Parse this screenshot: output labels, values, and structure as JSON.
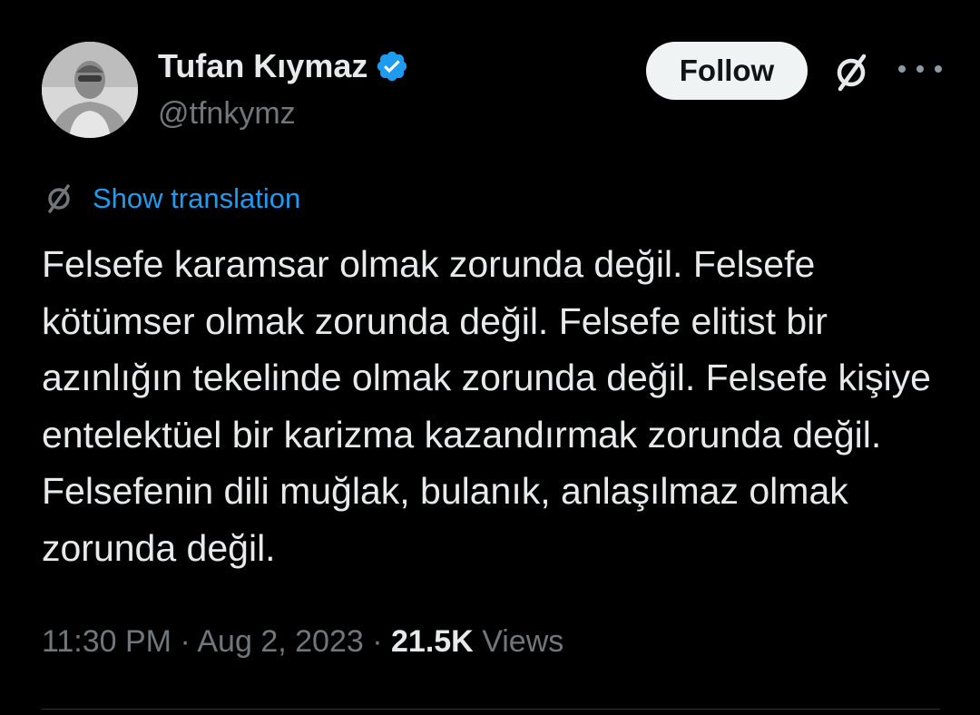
{
  "author": {
    "name": "Tufan Kıymaz",
    "handle": "@tfnkymz",
    "verified_color": "#1d9bf0"
  },
  "actions": {
    "follow_label": "Follow",
    "grok_icon": "grok-icon",
    "more_icon": "more-icon"
  },
  "translation": {
    "label": "Show translation",
    "icon": "translate-icon"
  },
  "tweet": {
    "text": "Felsefe karamsar olmak zorunda değil. Felsefe kötümser olmak zorunda değil. Felsefe elitist bir azınlığın tekelinde olmak zorunda değil. Felsefe kişiye entelektüel bir karizma kazandırmak zorunda değil. Felsefenin dili muğlak, bulanık, anlaşılmaz olmak zorunda değil."
  },
  "meta": {
    "time": "11:30 PM",
    "separator": "·",
    "date": "Aug 2, 2023",
    "views_count": "21.5K",
    "views_label": "Views"
  },
  "colors": {
    "background": "#000000",
    "text": "#e7e9ea",
    "muted": "#71767b",
    "link": "#1d9bf0"
  }
}
